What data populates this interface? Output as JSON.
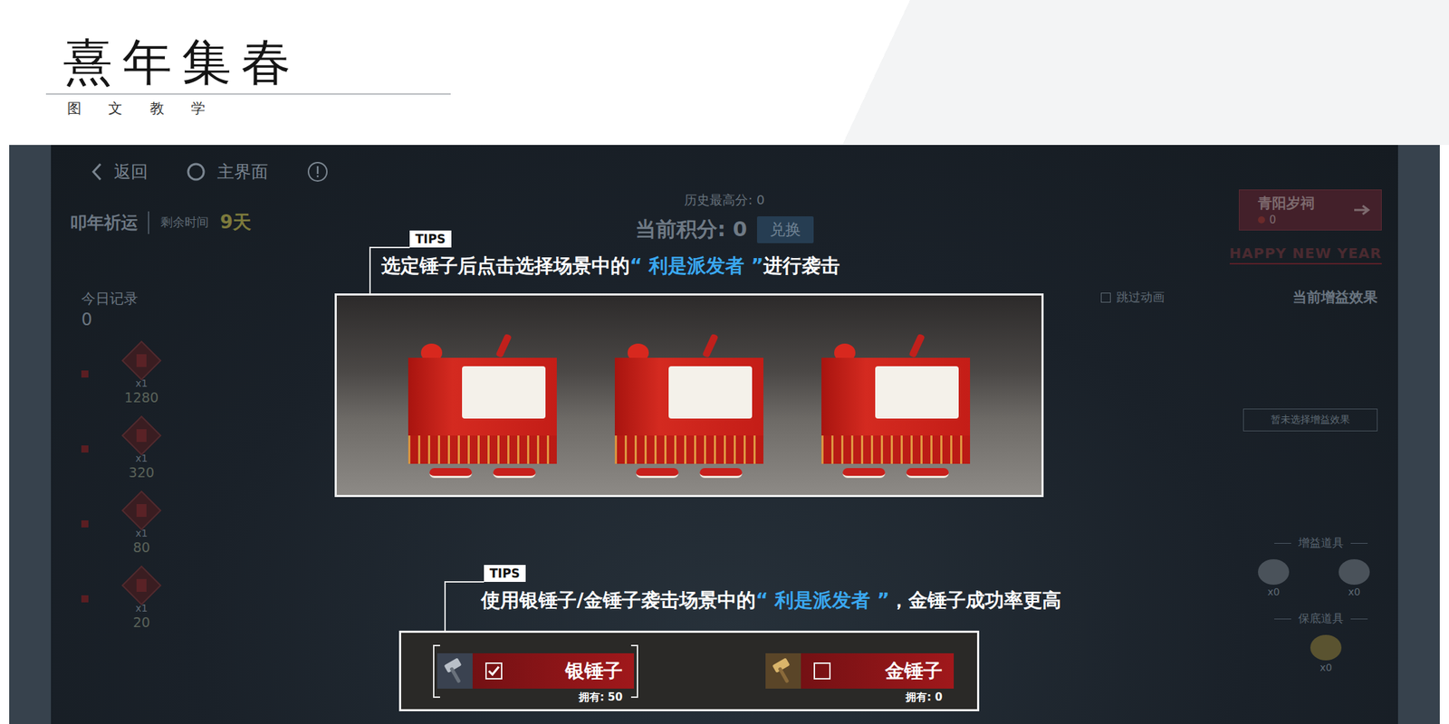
{
  "header": {
    "title": "熹年集春",
    "subtitle": "图 文 教 学"
  },
  "game": {
    "nav": {
      "back": "返回",
      "home": "主界面"
    },
    "event": {
      "title": "叩年祈运",
      "remaining_label": "剩余时间",
      "remaining": "9天"
    },
    "best_score": "历史最高分: 0",
    "score": "当前积分: 0",
    "exchange_button": "兑换",
    "shrine_button": {
      "label": "青阳岁祠",
      "count": "0"
    },
    "banner": "HAPPY NEW YEAR",
    "skip_animation": {
      "label": "跳过动画",
      "checked": false
    },
    "buff": {
      "title": "当前增益效果",
      "empty": "暂未选择增益效果"
    },
    "today": {
      "title": "今日记录",
      "count": "0"
    },
    "records": [
      {
        "multiplier": "x1",
        "points": "1280"
      },
      {
        "multiplier": "x1",
        "points": "320"
      },
      {
        "multiplier": "x1",
        "points": "80"
      },
      {
        "multiplier": "x1",
        "points": "20"
      }
    ],
    "boost_items": {
      "title": "增益道具",
      "items": [
        {
          "count": "x0"
        },
        {
          "count": "x0"
        }
      ]
    },
    "guarantee_items": {
      "title": "保底道具",
      "items": [
        {
          "count": "x0"
        }
      ]
    }
  },
  "tips": [
    {
      "tag": "TIPS",
      "parts": [
        {
          "text": "选定锤子后点击选择场景中的",
          "highlight": false
        },
        {
          "text": "“ 利是派发者 ”",
          "highlight": true
        },
        {
          "text": "进行袭击",
          "highlight": false
        }
      ]
    },
    {
      "tag": "TIPS",
      "parts": [
        {
          "text": "使用银锤子/金锤子袭击场景中的",
          "highlight": false
        },
        {
          "text": "“ 利是派发者 ”",
          "highlight": true
        },
        {
          "text": "，金锤子成功率更高",
          "highlight": false
        }
      ]
    }
  ],
  "hammers": [
    {
      "name": "银锤子",
      "owned": "拥有: 50",
      "checked": true,
      "kind": "silver"
    },
    {
      "name": "金锤子",
      "owned": "拥有: 0",
      "checked": false,
      "kind": "gold"
    }
  ]
}
